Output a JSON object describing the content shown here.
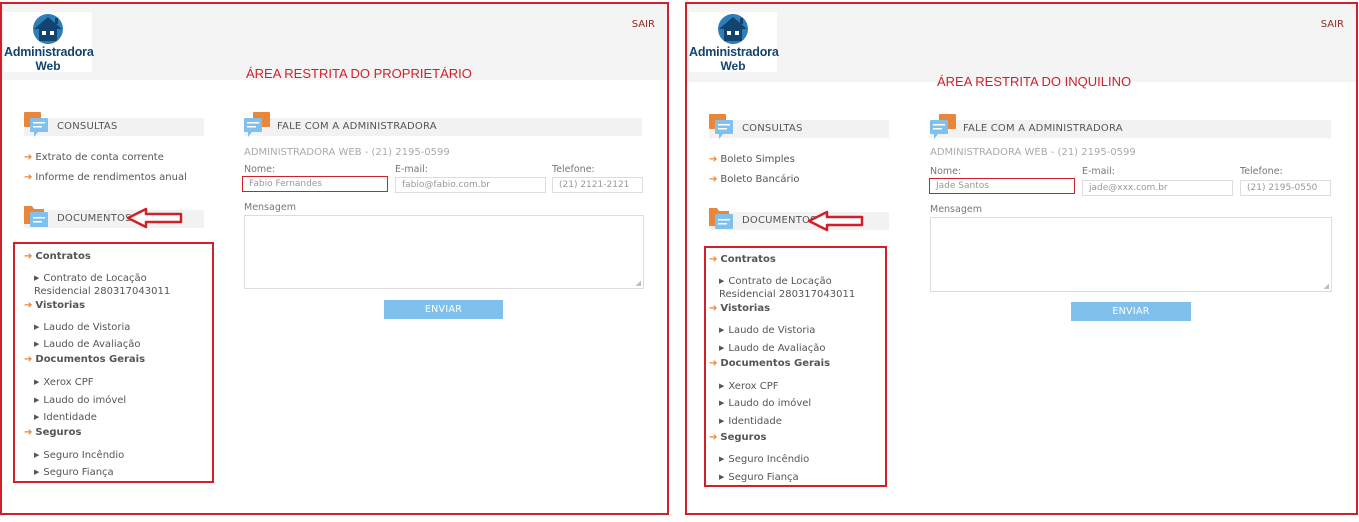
{
  "panels": [
    {
      "logo": {
        "line1": "Administradora",
        "line2": "Web"
      },
      "sair": "SAIR",
      "area_title": "ÁREA RESTRITA DO PROPRIETÁRIO",
      "consultas": {
        "title": "CONSULTAS",
        "items": [
          "Extrato de conta corrente",
          "Informe de rendimentos anual"
        ]
      },
      "documentos": {
        "title": "DOCUMENTOS",
        "categories": [
          {
            "name": "Contratos",
            "items": [
              "Contrato de Locação Residencial 280317043011"
            ]
          },
          {
            "name": "Vistorias",
            "items": [
              "Laudo de Vistoria",
              "Laudo de Avaliação"
            ]
          },
          {
            "name": "Documentos Gerais",
            "items": [
              "Xerox CPF",
              "Laudo do imóvel",
              "Identidade"
            ]
          },
          {
            "name": "Seguros",
            "items": [
              "Seguro Incêndio",
              "Seguro Fiança"
            ]
          }
        ]
      },
      "fale": {
        "title": "FALE COM A ADMINISTRADORA",
        "subtitle": "ADMINISTRADORA WEB - (21) 2195-0599",
        "nome_label": "Nome:",
        "nome_value": "Fabio Fernandes",
        "email_label": "E-mail:",
        "email_value": "fabio@fabio.com.br",
        "telefone_label": "Telefone:",
        "telefone_value": "(21) 2121-2121",
        "mensagem_label": "Mensagem",
        "send_label": "ENVIAR"
      }
    },
    {
      "logo": {
        "line1": "Administradora",
        "line2": "Web"
      },
      "sair": "SAIR",
      "area_title": "ÁREA RESTRITA DO INQUILINO",
      "consultas": {
        "title": "CONSULTAS",
        "items": [
          "Boleto Simples",
          "Boleto Bancário"
        ]
      },
      "documentos": {
        "title": "DOCUMENTOS",
        "categories": [
          {
            "name": "Contratos",
            "items": [
              "Contrato de Locação Residencial 280317043011"
            ]
          },
          {
            "name": "Vistorias",
            "items": [
              "Laudo de Vistoria",
              "Laudo de Avaliação"
            ]
          },
          {
            "name": "Documentos Gerais",
            "items": [
              "Xerox CPF",
              "Laudo do imóvel",
              "Identidade"
            ]
          },
          {
            "name": "Seguros",
            "items": [
              "Seguro Incêndio",
              "Seguro Fiança"
            ]
          }
        ]
      },
      "fale": {
        "title": "FALE COM A ADMINISTRADORA",
        "subtitle": "ADMINISTRADORA WEB - (21) 2195-0599",
        "nome_label": "Nome:",
        "nome_value": "Jade Santos",
        "email_label": "E-mail:",
        "email_value": "jade@xxx.com.br",
        "telefone_label": "Telefone:",
        "telefone_value": "(21) 2195-0550",
        "mensagem_label": "Mensagem",
        "send_label": "ENVIAR"
      }
    }
  ],
  "icons": {
    "logo": "house-logo-icon",
    "section": "chat-bubbles-icon",
    "folder": "folder-icon",
    "pointer": "red-arrow-icon"
  },
  "colors": {
    "highlight_red": "#d0212b",
    "accent_orange": "#e8873a",
    "button_blue": "#7fc0ec",
    "logo_blue": "#13446f"
  }
}
